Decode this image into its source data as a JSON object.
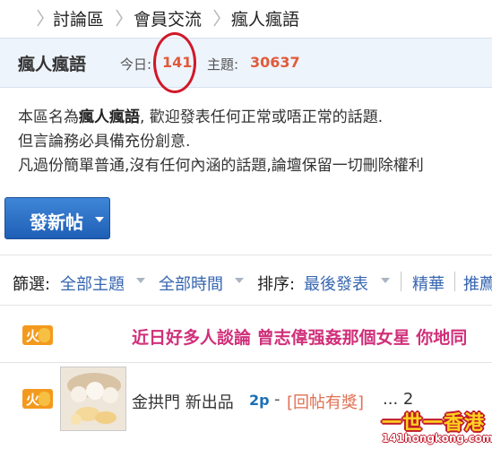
{
  "breadcrumb": {
    "items": [
      "討論區",
      "會員交流",
      "瘋人瘋語"
    ]
  },
  "forum": {
    "name": "瘋人瘋語",
    "today_label": "今日:",
    "today_count": "141",
    "topics_label": "主題:",
    "topics_count": "30637"
  },
  "description": {
    "line1_prefix": "本區名為",
    "line1_name": "瘋人瘋語",
    "line1_suffix": ", 歡迎發表任何正常或唔正常的話題.",
    "line2": "但言論務必具備充份創意.",
    "line3": "凡過份簡單普通,沒有任何內涵的話題,論壇保留一切刪除權利"
  },
  "new_post": {
    "label": "發新帖"
  },
  "filters": {
    "filter_label": "篩選:",
    "all_topics": "全部主題",
    "all_time": "全部時間",
    "sort_label": "排序:",
    "last_post": "最後發表",
    "digest": "精華",
    "recommend": "推薦"
  },
  "threads": [
    {
      "badge": "火",
      "title": "近日好多人談論 曾志偉强姦那個女星 你地同"
    },
    {
      "badge": "火",
      "title": "金拱門 新出品",
      "pages": "2p",
      "dash": "-",
      "tag": "[回帖有獎]",
      "more": "... 2"
    }
  ],
  "watermark": {
    "text": "一世一香港",
    "url": "141hongkong.com"
  },
  "colors": {
    "accent": "#3766b0",
    "stat": "#e05b3c",
    "hot_title": "#d0307a",
    "annotation": "#d0182a"
  }
}
